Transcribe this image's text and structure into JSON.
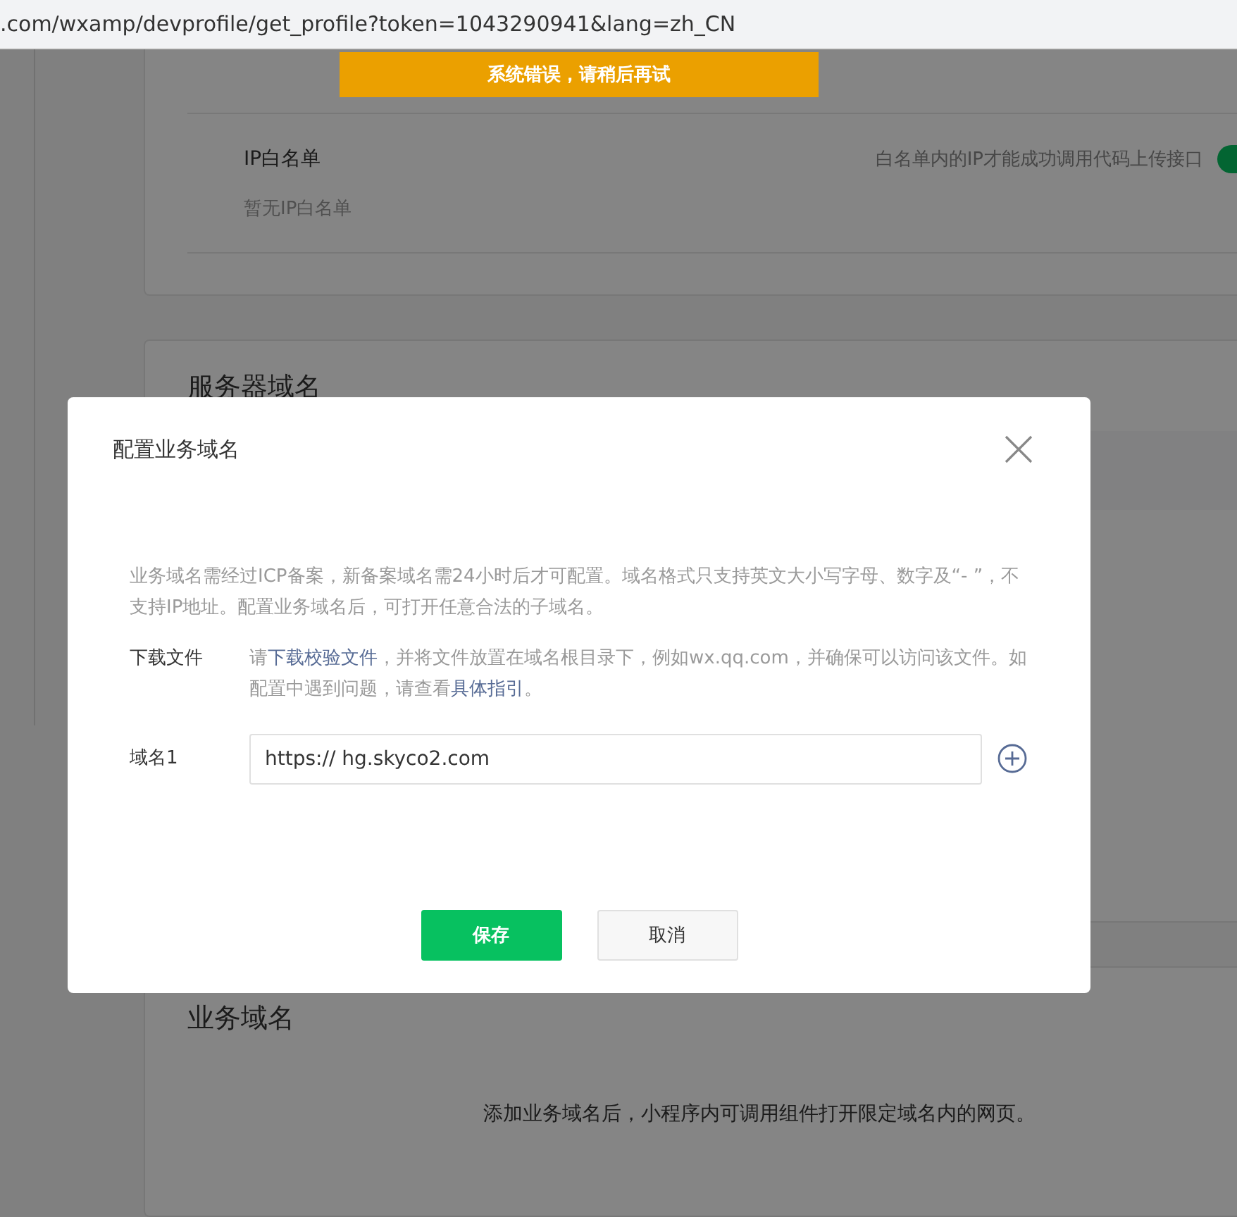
{
  "address_bar": {
    "url": ".com/wxamp/devprofile/get_profile?token=1043290941&lang=zh_CN"
  },
  "toast": {
    "message": "系统错误，请稍后再试"
  },
  "ip_whitelist": {
    "title": "IP白名单",
    "hint": "白名单内的IP才能成功调用代码上传接口",
    "on": true,
    "empty_text": "暂无IP白名单"
  },
  "server_domain": {
    "title": "服务器域名"
  },
  "business_domain": {
    "title": "业务域名",
    "description": "添加业务域名后，小程序内可调用组件打开限定域名内的网页。"
  },
  "dialog": {
    "title": "配置业务域名",
    "description": "业务域名需经过ICP备案，新备案域名需24小时后才可配置。域名格式只支持英文大小写字母、数字及“- ”，不支持IP地址。配置业务域名后，可打开任意合法的子域名。",
    "download": {
      "label": "下载文件",
      "parts": [
        {
          "kind": "text",
          "text": "请"
        },
        {
          "kind": "link",
          "text": "下载校验文件"
        },
        {
          "kind": "text",
          "text": "，并将文件放置在域名根目录下，例如wx.qq.com，并确保可以访问该文件。如配置中遇到问题，请查看"
        },
        {
          "kind": "link",
          "text": "具体指引"
        },
        {
          "kind": "text",
          "text": "。"
        }
      ]
    },
    "domains": [
      {
        "label": "域名1",
        "value": "https:// hg.skyco2.com"
      }
    ],
    "buttons": [
      {
        "label": "保存",
        "kind": "primary"
      },
      {
        "label": "取消",
        "kind": "default"
      }
    ]
  }
}
